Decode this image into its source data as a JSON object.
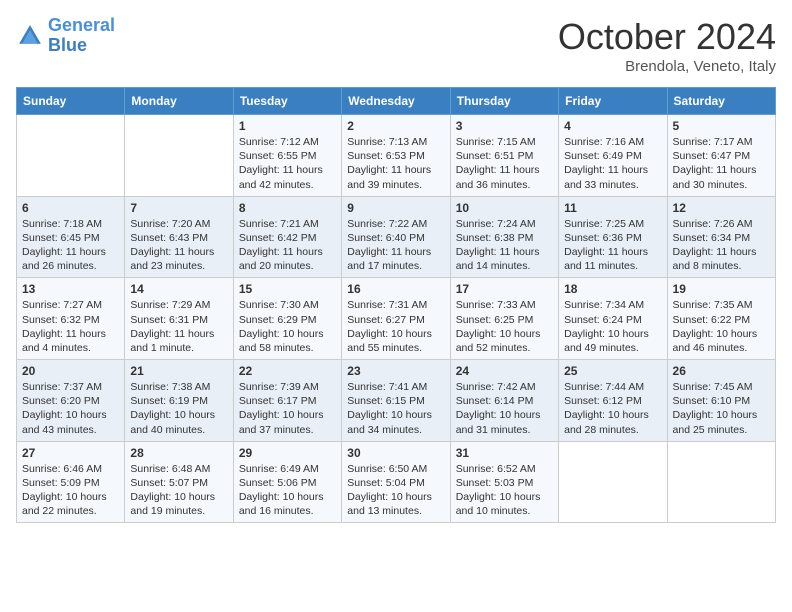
{
  "header": {
    "logo_line1": "General",
    "logo_line2": "Blue",
    "month": "October 2024",
    "location": "Brendola, Veneto, Italy"
  },
  "weekdays": [
    "Sunday",
    "Monday",
    "Tuesday",
    "Wednesday",
    "Thursday",
    "Friday",
    "Saturday"
  ],
  "weeks": [
    [
      {
        "day": "",
        "sunrise": "",
        "sunset": "",
        "daylight": ""
      },
      {
        "day": "",
        "sunrise": "",
        "sunset": "",
        "daylight": ""
      },
      {
        "day": "1",
        "sunrise": "Sunrise: 7:12 AM",
        "sunset": "Sunset: 6:55 PM",
        "daylight": "Daylight: 11 hours and 42 minutes."
      },
      {
        "day": "2",
        "sunrise": "Sunrise: 7:13 AM",
        "sunset": "Sunset: 6:53 PM",
        "daylight": "Daylight: 11 hours and 39 minutes."
      },
      {
        "day": "3",
        "sunrise": "Sunrise: 7:15 AM",
        "sunset": "Sunset: 6:51 PM",
        "daylight": "Daylight: 11 hours and 36 minutes."
      },
      {
        "day": "4",
        "sunrise": "Sunrise: 7:16 AM",
        "sunset": "Sunset: 6:49 PM",
        "daylight": "Daylight: 11 hours and 33 minutes."
      },
      {
        "day": "5",
        "sunrise": "Sunrise: 7:17 AM",
        "sunset": "Sunset: 6:47 PM",
        "daylight": "Daylight: 11 hours and 30 minutes."
      }
    ],
    [
      {
        "day": "6",
        "sunrise": "Sunrise: 7:18 AM",
        "sunset": "Sunset: 6:45 PM",
        "daylight": "Daylight: 11 hours and 26 minutes."
      },
      {
        "day": "7",
        "sunrise": "Sunrise: 7:20 AM",
        "sunset": "Sunset: 6:43 PM",
        "daylight": "Daylight: 11 hours and 23 minutes."
      },
      {
        "day": "8",
        "sunrise": "Sunrise: 7:21 AM",
        "sunset": "Sunset: 6:42 PM",
        "daylight": "Daylight: 11 hours and 20 minutes."
      },
      {
        "day": "9",
        "sunrise": "Sunrise: 7:22 AM",
        "sunset": "Sunset: 6:40 PM",
        "daylight": "Daylight: 11 hours and 17 minutes."
      },
      {
        "day": "10",
        "sunrise": "Sunrise: 7:24 AM",
        "sunset": "Sunset: 6:38 PM",
        "daylight": "Daylight: 11 hours and 14 minutes."
      },
      {
        "day": "11",
        "sunrise": "Sunrise: 7:25 AM",
        "sunset": "Sunset: 6:36 PM",
        "daylight": "Daylight: 11 hours and 11 minutes."
      },
      {
        "day": "12",
        "sunrise": "Sunrise: 7:26 AM",
        "sunset": "Sunset: 6:34 PM",
        "daylight": "Daylight: 11 hours and 8 minutes."
      }
    ],
    [
      {
        "day": "13",
        "sunrise": "Sunrise: 7:27 AM",
        "sunset": "Sunset: 6:32 PM",
        "daylight": "Daylight: 11 hours and 4 minutes."
      },
      {
        "day": "14",
        "sunrise": "Sunrise: 7:29 AM",
        "sunset": "Sunset: 6:31 PM",
        "daylight": "Daylight: 11 hours and 1 minute."
      },
      {
        "day": "15",
        "sunrise": "Sunrise: 7:30 AM",
        "sunset": "Sunset: 6:29 PM",
        "daylight": "Daylight: 10 hours and 58 minutes."
      },
      {
        "day": "16",
        "sunrise": "Sunrise: 7:31 AM",
        "sunset": "Sunset: 6:27 PM",
        "daylight": "Daylight: 10 hours and 55 minutes."
      },
      {
        "day": "17",
        "sunrise": "Sunrise: 7:33 AM",
        "sunset": "Sunset: 6:25 PM",
        "daylight": "Daylight: 10 hours and 52 minutes."
      },
      {
        "day": "18",
        "sunrise": "Sunrise: 7:34 AM",
        "sunset": "Sunset: 6:24 PM",
        "daylight": "Daylight: 10 hours and 49 minutes."
      },
      {
        "day": "19",
        "sunrise": "Sunrise: 7:35 AM",
        "sunset": "Sunset: 6:22 PM",
        "daylight": "Daylight: 10 hours and 46 minutes."
      }
    ],
    [
      {
        "day": "20",
        "sunrise": "Sunrise: 7:37 AM",
        "sunset": "Sunset: 6:20 PM",
        "daylight": "Daylight: 10 hours and 43 minutes."
      },
      {
        "day": "21",
        "sunrise": "Sunrise: 7:38 AM",
        "sunset": "Sunset: 6:19 PM",
        "daylight": "Daylight: 10 hours and 40 minutes."
      },
      {
        "day": "22",
        "sunrise": "Sunrise: 7:39 AM",
        "sunset": "Sunset: 6:17 PM",
        "daylight": "Daylight: 10 hours and 37 minutes."
      },
      {
        "day": "23",
        "sunrise": "Sunrise: 7:41 AM",
        "sunset": "Sunset: 6:15 PM",
        "daylight": "Daylight: 10 hours and 34 minutes."
      },
      {
        "day": "24",
        "sunrise": "Sunrise: 7:42 AM",
        "sunset": "Sunset: 6:14 PM",
        "daylight": "Daylight: 10 hours and 31 minutes."
      },
      {
        "day": "25",
        "sunrise": "Sunrise: 7:44 AM",
        "sunset": "Sunset: 6:12 PM",
        "daylight": "Daylight: 10 hours and 28 minutes."
      },
      {
        "day": "26",
        "sunrise": "Sunrise: 7:45 AM",
        "sunset": "Sunset: 6:10 PM",
        "daylight": "Daylight: 10 hours and 25 minutes."
      }
    ],
    [
      {
        "day": "27",
        "sunrise": "Sunrise: 6:46 AM",
        "sunset": "Sunset: 5:09 PM",
        "daylight": "Daylight: 10 hours and 22 minutes."
      },
      {
        "day": "28",
        "sunrise": "Sunrise: 6:48 AM",
        "sunset": "Sunset: 5:07 PM",
        "daylight": "Daylight: 10 hours and 19 minutes."
      },
      {
        "day": "29",
        "sunrise": "Sunrise: 6:49 AM",
        "sunset": "Sunset: 5:06 PM",
        "daylight": "Daylight: 10 hours and 16 minutes."
      },
      {
        "day": "30",
        "sunrise": "Sunrise: 6:50 AM",
        "sunset": "Sunset: 5:04 PM",
        "daylight": "Daylight: 10 hours and 13 minutes."
      },
      {
        "day": "31",
        "sunrise": "Sunrise: 6:52 AM",
        "sunset": "Sunset: 5:03 PM",
        "daylight": "Daylight: 10 hours and 10 minutes."
      },
      {
        "day": "",
        "sunrise": "",
        "sunset": "",
        "daylight": ""
      },
      {
        "day": "",
        "sunrise": "",
        "sunset": "",
        "daylight": ""
      }
    ]
  ]
}
